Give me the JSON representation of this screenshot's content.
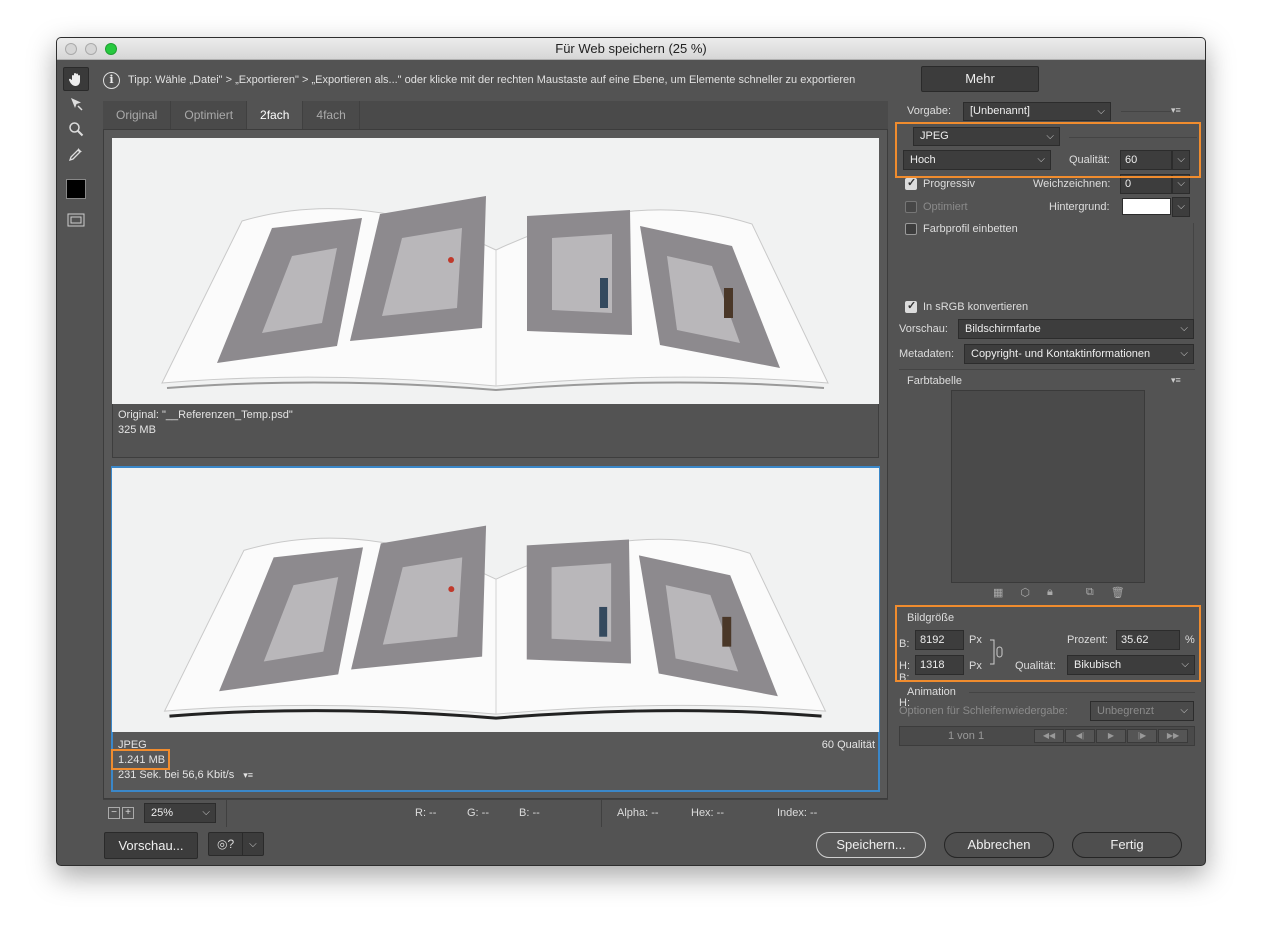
{
  "window": {
    "title": "Für Web speichern (25 %)"
  },
  "tip": {
    "text": "Tipp: Wähle „Datei\" > „Exportieren\" > „Exportieren als...\" oder klicke mit der rechten Maustaste auf eine Ebene, um Elemente schneller zu exportieren",
    "more": "Mehr"
  },
  "tabs": [
    "Original",
    "Optimiert",
    "2fach",
    "4fach"
  ],
  "original": {
    "line1": "Original: \"__Referenzen_Temp.psd\"",
    "line2": "325 MB"
  },
  "optimized": {
    "format": "JPEG",
    "size": "1.241 MB",
    "time": "231 Sek. bei 56,6 Kbit/s",
    "quality": "60 Qualität"
  },
  "statusbar": {
    "zoom": "25%",
    "r": "R: --",
    "g": "G: --",
    "b": "B: --",
    "alpha": "Alpha: --",
    "hex": "Hex: --",
    "index": "Index: --"
  },
  "panel": {
    "preset_label": "Vorgabe:",
    "preset_value": "[Unbenannt]",
    "format": "JPEG",
    "compression": "Hoch",
    "quality_label": "Qualität:",
    "quality_value": "60",
    "progressive": "Progressiv",
    "blur_label": "Weichzeichnen:",
    "blur_value": "0",
    "optimized": "Optimiert",
    "matte_label": "Hintergrund:",
    "embed_profile": "Farbprofil einbetten",
    "srgb": "In sRGB konvertieren",
    "preview_label": "Vorschau:",
    "preview_value": "Bildschirmfarbe",
    "metadata_label": "Metadaten:",
    "metadata_value": "Copyright- und Kontaktinformationen",
    "color_table": "Farbtabelle"
  },
  "imagesize": {
    "title": "Bildgröße",
    "w_label": "B:",
    "w_value": "8192",
    "h_label": "H:",
    "h_value": "1318",
    "unit": "Px",
    "percent_label": "Prozent:",
    "percent_value": "35.62",
    "percent_sign": "%",
    "quality_label": "Qualität:",
    "quality_value": "Bikubisch"
  },
  "animation": {
    "title": "Animation",
    "loop_label": "Optionen für Schleifenwiedergabe:",
    "loop_value": "Unbegrenzt",
    "frame": "1 von 1"
  },
  "buttons": {
    "preview": "Vorschau...",
    "save": "Speichern...",
    "cancel": "Abbrechen",
    "done": "Fertig"
  },
  "colors": {
    "accent": "#f08c2e",
    "selection": "#3a87c9"
  }
}
